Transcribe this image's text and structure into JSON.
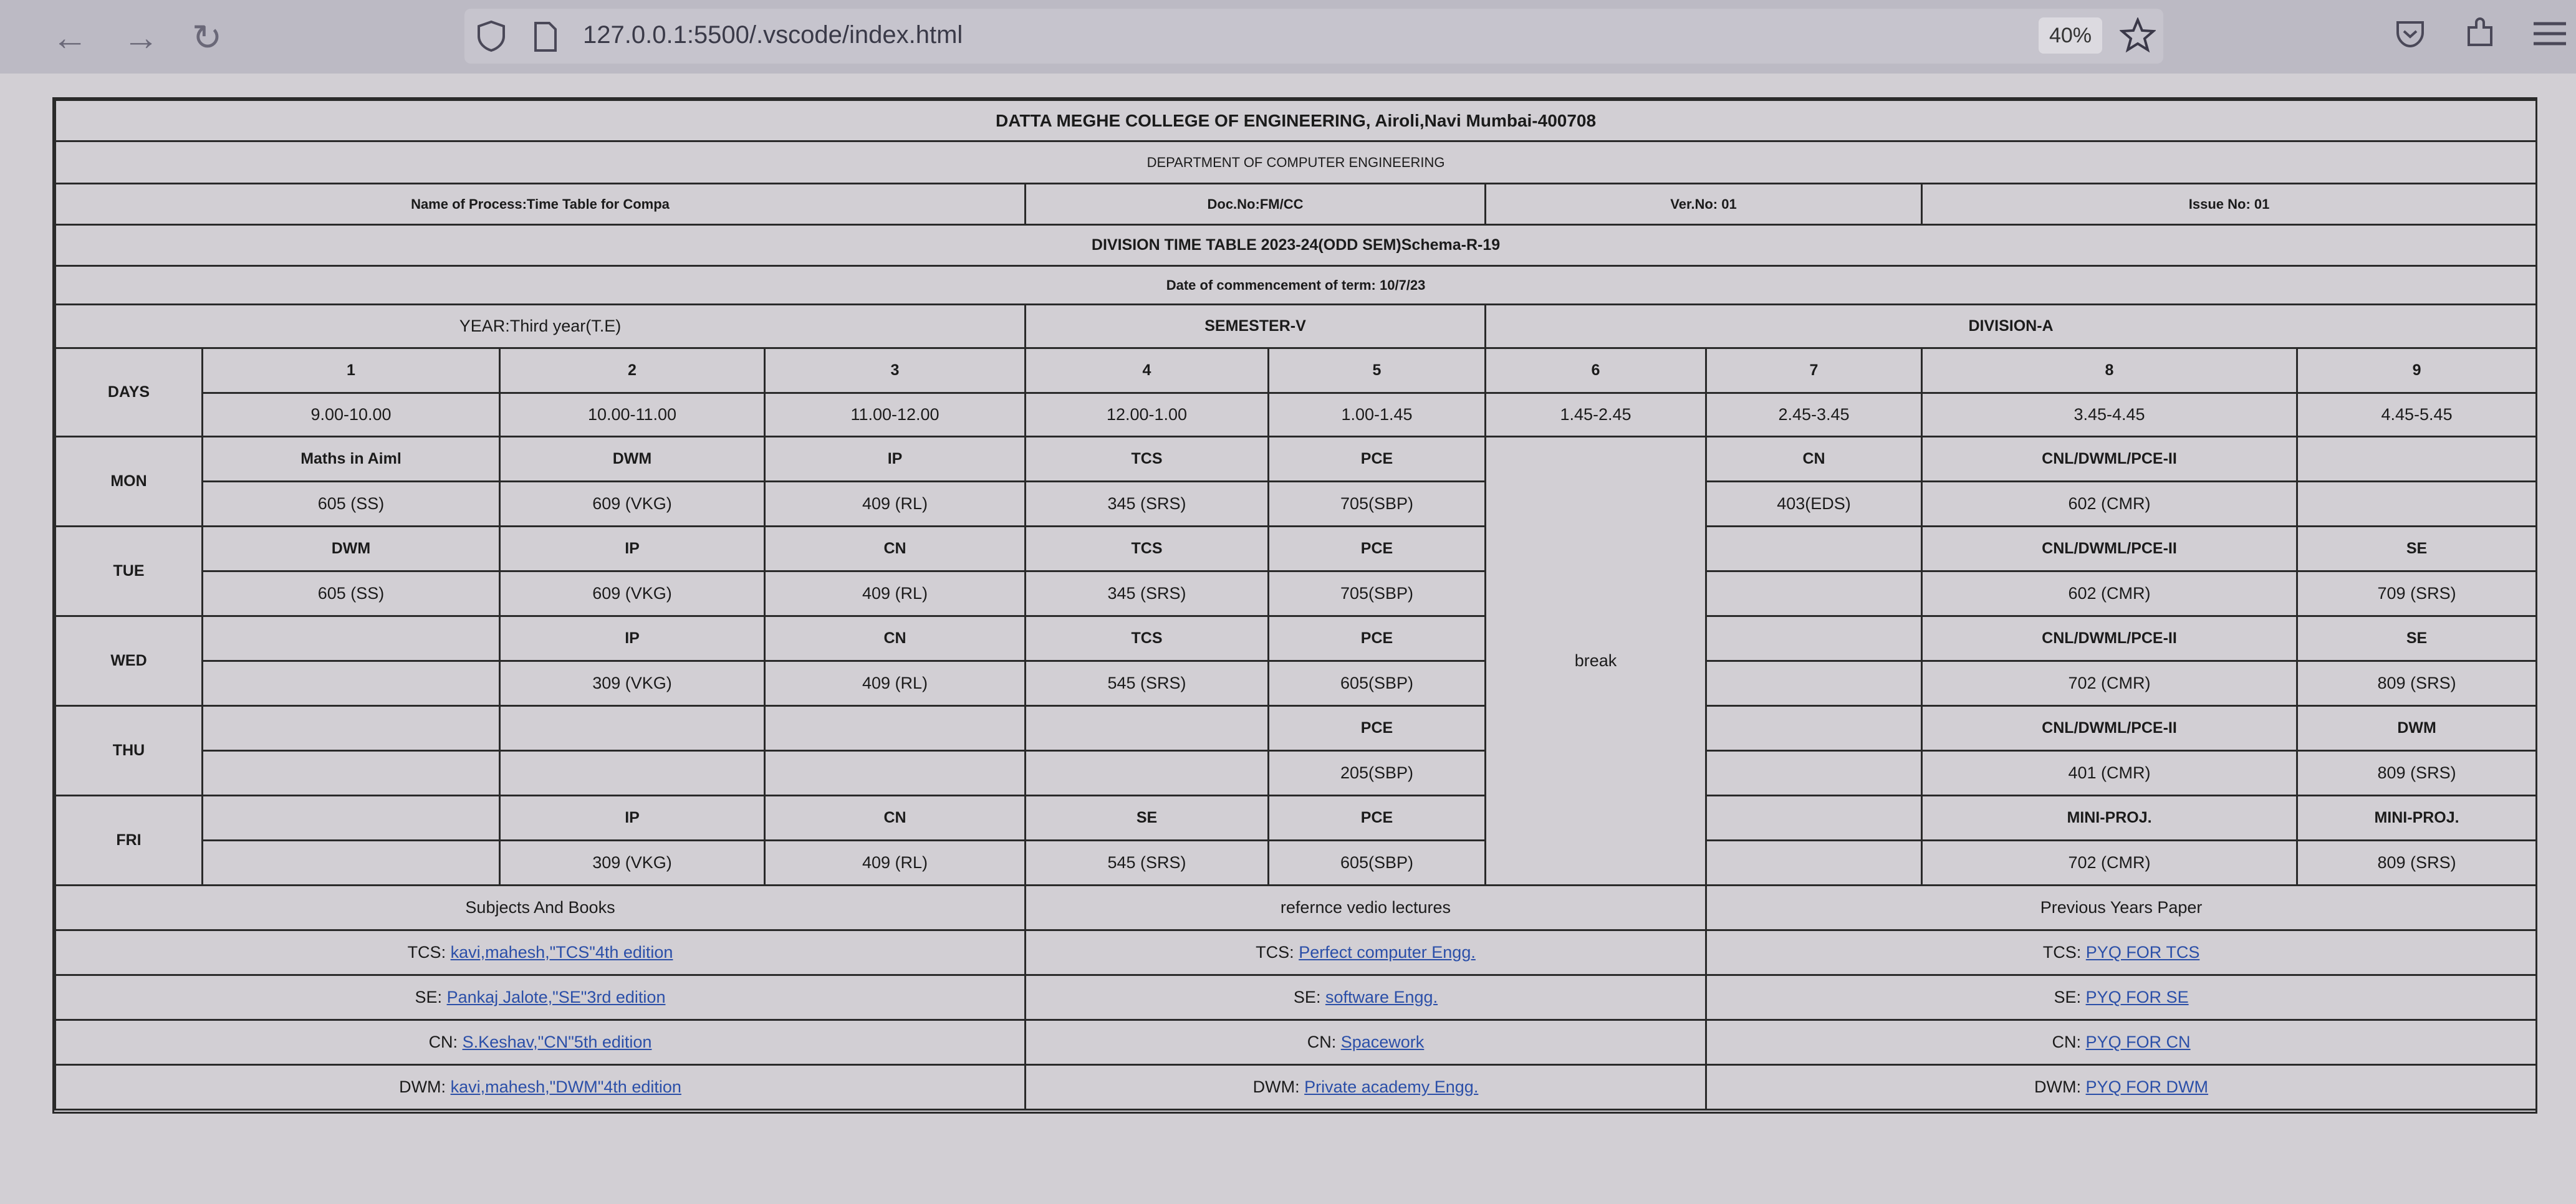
{
  "browser": {
    "url": "127.0.0.1:5500/.vscode/index.html",
    "zoom": "40%"
  },
  "header": {
    "college": "DATTA MEGHE COLLEGE OF ENGINEERING, Airoli,Navi Mumbai-400708",
    "department": "DEPARTMENT OF COMPUTER ENGINEERING",
    "process": "Name of Process:Time Table for Compa",
    "doc_no": "Doc.No:FM/CC",
    "ver_no": "Ver.No: 01",
    "issue_no": "Issue No: 01",
    "division_title": "DIVISION TIME TABLE 2023-24(ODD SEM)Schema-R-19",
    "commencement": "Date of commencement of term: 10/7/23",
    "year": "YEAR:Third year(T.E)",
    "semester": "SEMESTER-V",
    "division": "DIVISION-A"
  },
  "timetable": {
    "days_label": "DAYS",
    "periods": [
      "1",
      "2",
      "3",
      "4",
      "5",
      "6",
      "7",
      "8",
      "9"
    ],
    "times": [
      "9.00-10.00",
      "10.00-11.00",
      "11.00-12.00",
      "12.00-1.00",
      "1.00-1.45",
      "1.45-2.45",
      "2.45-3.45",
      "3.45-4.45",
      "4.45-5.45"
    ],
    "break_label": "break",
    "days": [
      {
        "day": "MON",
        "subjects": [
          "Maths in Aiml",
          "DWM",
          "IP",
          "TCS",
          "PCE",
          "CN",
          "CNL/DWML/PCE-II",
          ""
        ],
        "rooms": [
          "605 (SS)",
          "609 (VKG)",
          "409 (RL)",
          "345 (SRS)",
          "705(SBP)",
          "403(EDS)",
          "602 (CMR)",
          ""
        ]
      },
      {
        "day": "TUE",
        "subjects": [
          "DWM",
          "IP",
          "CN",
          "TCS",
          "PCE",
          "",
          "CNL/DWML/PCE-II",
          "SE"
        ],
        "rooms": [
          "605 (SS)",
          "609 (VKG)",
          "409 (RL)",
          "345 (SRS)",
          "705(SBP)",
          "",
          "602 (CMR)",
          "709 (SRS)"
        ]
      },
      {
        "day": "WED",
        "subjects": [
          "",
          "IP",
          "CN",
          "TCS",
          "PCE",
          "",
          "CNL/DWML/PCE-II",
          "SE"
        ],
        "rooms": [
          "",
          "309 (VKG)",
          "409 (RL)",
          "545 (SRS)",
          "605(SBP)",
          "",
          "702 (CMR)",
          "809 (SRS)"
        ]
      },
      {
        "day": "THU",
        "subjects": [
          "",
          "",
          "",
          "",
          "PCE",
          "",
          "CNL/DWML/PCE-II",
          "DWM"
        ],
        "rooms": [
          "",
          "",
          "",
          "",
          "205(SBP)",
          "",
          "401 (CMR)",
          "809 (SRS)"
        ]
      },
      {
        "day": "FRI",
        "subjects": [
          "",
          "IP",
          "CN",
          "SE",
          "PCE",
          "",
          "MINI-PROJ.",
          "MINI-PROJ."
        ],
        "rooms": [
          "",
          "309 (VKG)",
          "409 (RL)",
          "545 (SRS)",
          "605(SBP)",
          "",
          "702 (CMR)",
          "809 (SRS)"
        ]
      }
    ]
  },
  "resources": {
    "headers": [
      "Subjects And Books",
      "refernce vedio lectures",
      "Previous Years Paper"
    ],
    "rows": [
      {
        "books_prefix": "TCS:",
        "books_link": "kavi,mahesh,\"TCS\"4th edition",
        "video_prefix": "TCS:",
        "video_link": "Perfect computer Engg.",
        "pyq_prefix": "TCS:",
        "pyq_link": "PYQ FOR TCS"
      },
      {
        "books_prefix": "SE:",
        "books_link": "Pankaj Jalote,\"SE\"3rd edition",
        "video_prefix": "SE:",
        "video_link": "software Engg.",
        "pyq_prefix": "SE:",
        "pyq_link": "PYQ FOR SE"
      },
      {
        "books_prefix": "CN:",
        "books_link": "S.Keshav,\"CN\"5th edition",
        "video_prefix": "CN:",
        "video_link": "Spacework",
        "pyq_prefix": "CN:",
        "pyq_link": "PYQ FOR CN"
      },
      {
        "books_prefix": "DWM:",
        "books_link": "kavi,mahesh,\"DWM\"4th edition",
        "video_prefix": "DWM:",
        "video_link": "Private academy Engg.",
        "pyq_prefix": "DWM:",
        "pyq_link": "PYQ FOR DWM"
      }
    ]
  },
  "icons": [
    "back-arrow-icon",
    "forward-arrow-icon",
    "reload-icon",
    "shield-icon",
    "page-icon",
    "star-icon",
    "pocket-icon",
    "extensions-icon",
    "menu-icon"
  ]
}
